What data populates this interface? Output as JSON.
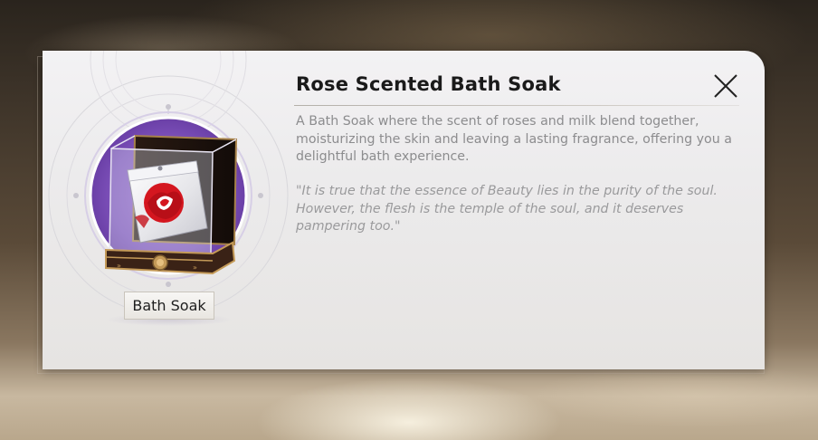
{
  "item": {
    "name": "Rose Scented Bath Soak",
    "type_tag": "Bath Soak",
    "description": "A Bath Soak where the scent of roses and milk blend together, moisturizing the skin and leaving a lasting fragrance, offering you a delightful bath experience.",
    "flavor_text": "\"It is true that the essence of Beauty lies in the purity of the soul. However, the flesh is the temple of the soul, and it deserves pampering too.\"",
    "image_subject": "rose-bath-soak-pouch-in-display-box",
    "rarity_color": "#7b4fb8"
  },
  "icons": {
    "close": "close-icon"
  }
}
